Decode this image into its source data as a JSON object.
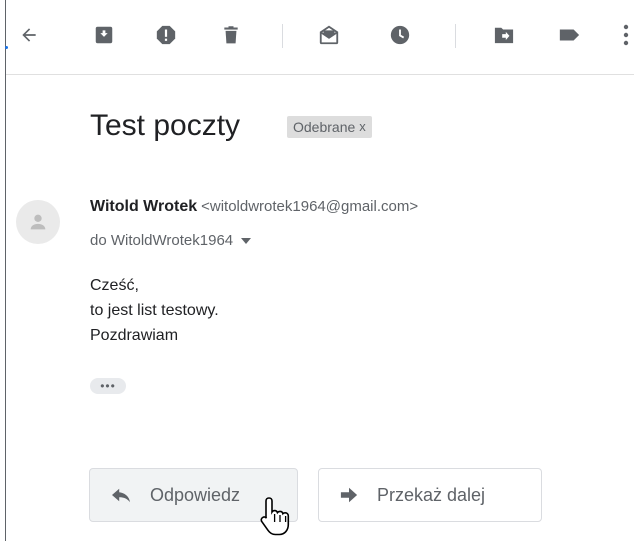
{
  "toolbar": {
    "icons": [
      {
        "name": "back-arrow-icon",
        "tooltip": ""
      },
      {
        "name": "archive-icon"
      },
      {
        "name": "report-spam-icon"
      },
      {
        "name": "delete-icon"
      },
      {
        "name": "mark-unread-icon"
      },
      {
        "name": "snooze-icon"
      },
      {
        "name": "move-to-icon"
      },
      {
        "name": "label-icon"
      },
      {
        "name": "more-vert-icon"
      }
    ]
  },
  "message": {
    "subject": "Test poczty",
    "label": "Odebrane",
    "label_close": "x",
    "sender_name": "Witold Wrotek",
    "sender_email": "<witoldwrotek1964@gmail.com>",
    "to_line": "do WitoldWrotek1964",
    "body_lines": [
      "Cześć,",
      "to jest list testowy.",
      "Pozdrawiam"
    ],
    "ellipsis": "•••"
  },
  "actions": {
    "reply_label": "Odpowiedz",
    "forward_label": "Przekaż dalej"
  },
  "colors": {
    "icon": "#5f6368",
    "text": "#202124",
    "chip_bg": "#dddddd"
  }
}
